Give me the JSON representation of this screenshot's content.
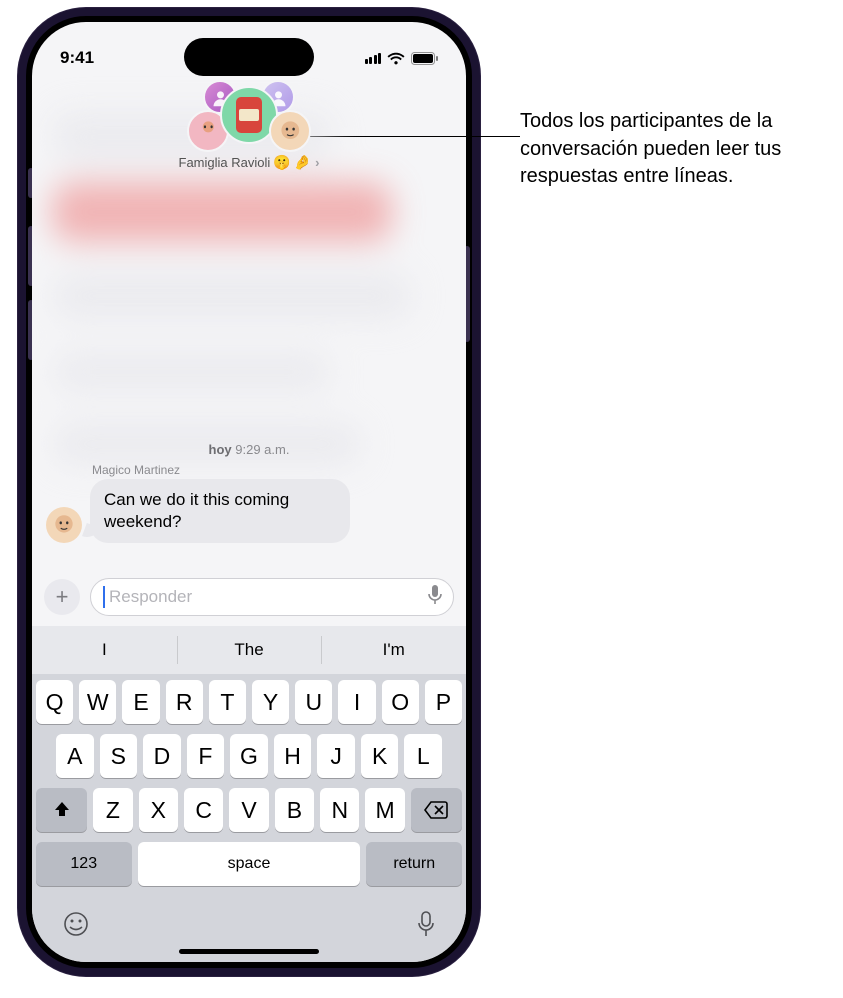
{
  "status": {
    "time": "9:41"
  },
  "header": {
    "group_name": "Famiglia Ravioli",
    "emoji1": "🤫",
    "emoji2": "🤌"
  },
  "timestamp": {
    "prefix": "hoy",
    "time": "9:29 a.m."
  },
  "message": {
    "sender": "Magico Martinez",
    "text": "Can we do it this coming weekend?"
  },
  "input": {
    "placeholder": "Responder"
  },
  "suggestions": [
    "I",
    "The",
    "I'm"
  ],
  "keyboard": {
    "row1": [
      "Q",
      "W",
      "E",
      "R",
      "T",
      "Y",
      "U",
      "I",
      "O",
      "P"
    ],
    "row2": [
      "A",
      "S",
      "D",
      "F",
      "G",
      "H",
      "J",
      "K",
      "L"
    ],
    "row3": [
      "Z",
      "X",
      "C",
      "V",
      "B",
      "N",
      "M"
    ],
    "num_key": "123",
    "space_key": "space",
    "return_key": "return"
  },
  "callout": {
    "text": "Todos los participantes de la conversación pueden leer tus respuestas entre líneas."
  }
}
